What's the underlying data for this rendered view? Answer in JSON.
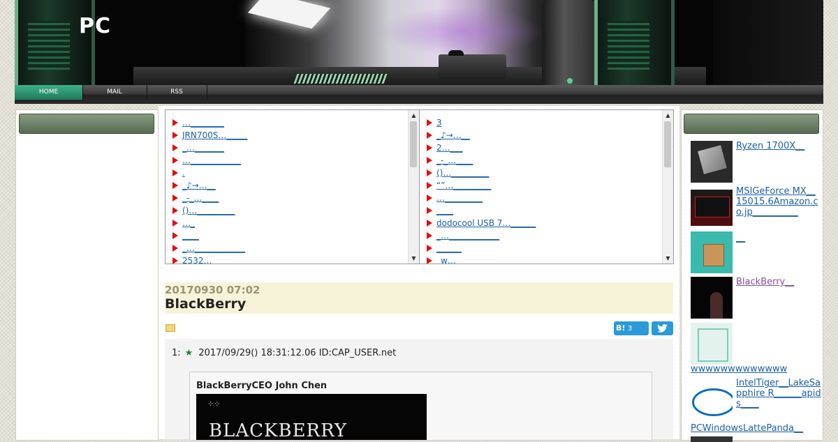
{
  "site": {
    "title": "PC"
  },
  "nav": {
    "items": [
      "HOME",
      "MAIL",
      "RSS"
    ]
  },
  "lists": {
    "left": [
      "…________",
      "JRN700S…_____",
      "_…_______",
      "…____________",
      ".",
      "_♪→…__",
      "_-_…____",
      "()…_________",
      "…_",
      "____",
      "_…____________",
      "2532…"
    ],
    "right": [
      "3",
      "_♪→…__",
      "2…___",
      "_-_…____",
      "()…_________",
      "“”…_________",
      "…_________",
      "____",
      "dodocool USB 7…______",
      "_…____________",
      "______",
      "_w…"
    ]
  },
  "article": {
    "date": "20170930 07:02",
    "title": "BlackBerry",
    "hatena_label": "B!",
    "hatena_count": "3",
    "post_number": "1:",
    "post_star": "★",
    "post_meta": "2017/09/29() 18:31:12.06 ID:CAP_USER.net",
    "quote_caption": "BlackBerryCEO John Chen",
    "quote_image_logo": "BLACKBERRY"
  },
  "sidebar_right": {
    "items": [
      {
        "text": "Ryzen 1700X__",
        "thumb": "cpu-icon"
      },
      {
        "text": "MSIGeForce MX__15015.6Amazon.co.jp__________",
        "thumb": "laptop-icon"
      },
      {
        "text": "__",
        "thumb": "delivery-icon"
      },
      {
        "text": "BlackBerry__",
        "thumb": "blackberry-ceo-icon"
      },
      {
        "text": "wwwwwwwwwwwww",
        "thumb": "device-icon"
      },
      {
        "text": "IntelTiger__LakeSapphire R______apids____",
        "thumb": "intel-icon"
      },
      {
        "text": "PCWindowsLattePanda__",
        "thumb": ""
      }
    ]
  },
  "colors": {
    "accent": "#2a9ad8",
    "link": "#1a5fa8",
    "nav_active": "#2f9a74",
    "side_head": "#6e8268"
  }
}
